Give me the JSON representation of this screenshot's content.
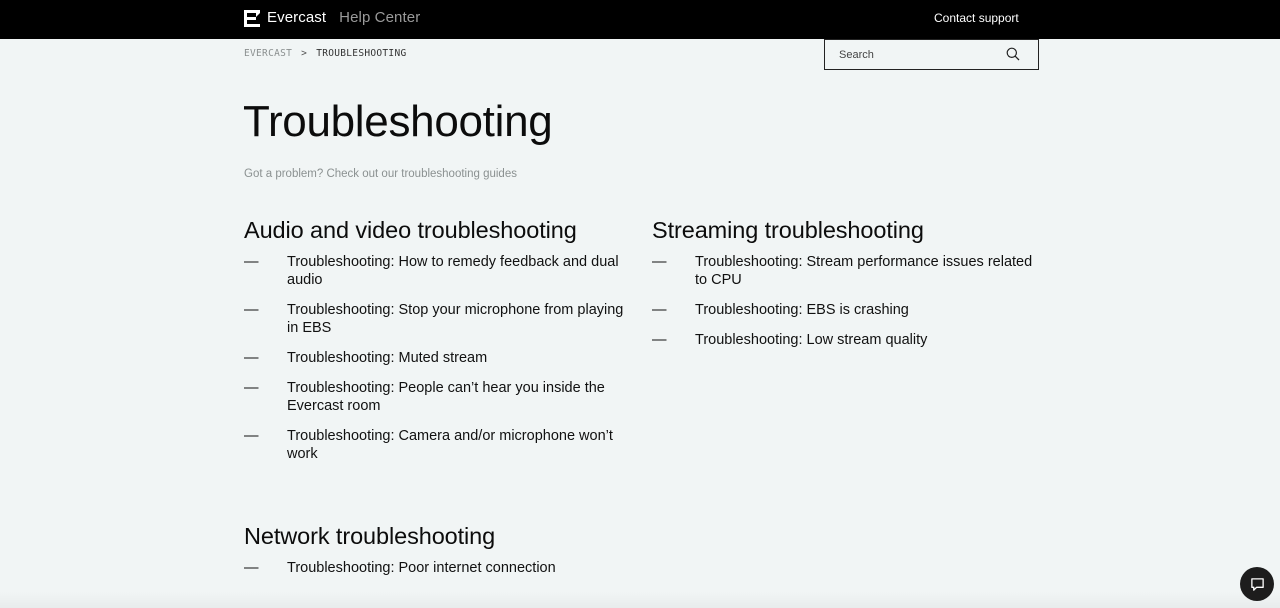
{
  "header": {
    "brand_name": "Evercast",
    "brand_sub": "Help Center",
    "contact_label": "Contact support"
  },
  "breadcrumb": {
    "root": "EVERCAST",
    "separator": ">",
    "current": "TROUBLESHOOTING"
  },
  "search": {
    "placeholder": "Search"
  },
  "page": {
    "title": "Troubleshooting",
    "subtitle": "Got a problem? Check out our troubleshooting guides"
  },
  "sections": {
    "av": {
      "title": "Audio and video troubleshooting",
      "articles": [
        "Troubleshooting: How to remedy feedback and dual audio",
        "Troubleshooting: Stop your microphone from playing in EBS",
        "Troubleshooting: Muted stream",
        "Troubleshooting: People can’t hear you inside the Evercast room",
        "Troubleshooting: Camera and/or microphone won’t work"
      ]
    },
    "stream": {
      "title": "Streaming troubleshooting",
      "articles": [
        "Troubleshooting: Stream performance issues related to CPU",
        "Troubleshooting: EBS is crashing",
        "Troubleshooting: Low stream quality"
      ]
    },
    "net": {
      "title": "Network troubleshooting",
      "articles": [
        "Troubleshooting: Poor internet connection"
      ]
    }
  },
  "list_marker": "—",
  "icons": {
    "logo": "evercast-logo-icon",
    "search": "search-icon",
    "chat": "chat-icon"
  },
  "colors": {
    "background": "#f1f5f5",
    "topbar": "#000000",
    "text": "#111111",
    "muted": "#8b9191"
  }
}
